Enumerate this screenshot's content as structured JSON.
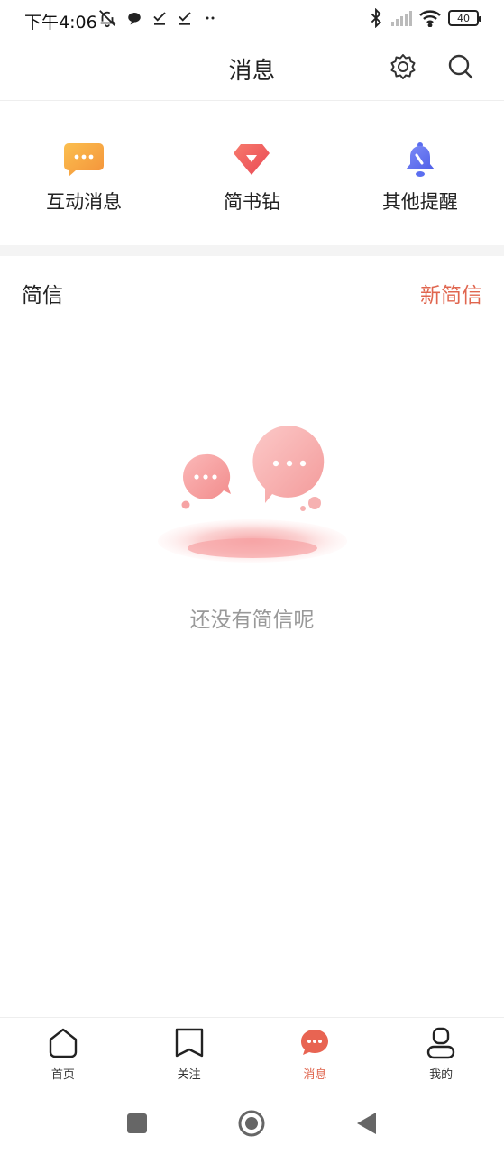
{
  "status_bar": {
    "time": "下午4:06",
    "battery": "40"
  },
  "header": {
    "title": "消息"
  },
  "categories": [
    {
      "label": "互动消息",
      "icon": "chat-bubble-icon",
      "color": "#f6a33b"
    },
    {
      "label": "简书钻",
      "icon": "diamond-icon",
      "color": "#ee5b5b"
    },
    {
      "label": "其他提醒",
      "icon": "bell-icon",
      "color": "#5b6ef0"
    }
  ],
  "section": {
    "title": "简信",
    "new_label": "新简信"
  },
  "empty_state": {
    "text": "还没有简信呢"
  },
  "bottom_nav": [
    {
      "label": "首页",
      "icon": "home-icon",
      "active": false
    },
    {
      "label": "关注",
      "icon": "bookmark-icon",
      "active": false
    },
    {
      "label": "消息",
      "icon": "message-icon",
      "active": true
    },
    {
      "label": "我的",
      "icon": "profile-icon",
      "active": false
    }
  ],
  "colors": {
    "accent": "#e0664f",
    "text": "#222222",
    "muted": "#999999"
  }
}
